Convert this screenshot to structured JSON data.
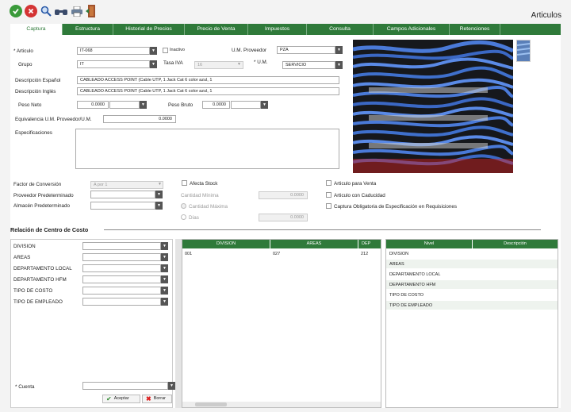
{
  "window_title": "Articulos",
  "tabs": [
    "Captura",
    "Estructura",
    "Historial de Precios",
    "Precio de Venta",
    "Impuestos",
    "Consulta",
    "Campos Adicionales",
    "Retenciones"
  ],
  "form": {
    "articulo_label": "* Articulo",
    "articulo_value": "IT-068",
    "inactivo_label": "Inactivo",
    "um_proveedor_label": "U.M. Proveedor",
    "um_proveedor_value": "PZA",
    "grupo_label": "Grupo",
    "grupo_value": "IT",
    "tasa_iva_label": "Tasa IVA",
    "tasa_iva_value": "16",
    "um_label": "* U.M.",
    "um_value": "SERVICIO",
    "desc_es_label": "Descripción Español",
    "desc_es_value": "CABLEADO ACCESS POINT (Cable UTP, 1 Jack Cat 6 color azul, 1",
    "desc_en_label": "Descripción Inglés",
    "desc_en_value": "CABLEADO ACCESS POINT (Cable UTP, 1 Jack Cat 6 color azul, 1",
    "peso_neto_label": "Peso Neto",
    "peso_neto_value": "0.0000",
    "peso_bruto_label": "Peso Bruto",
    "peso_bruto_value": "0.0000",
    "equivalencia_label": "Equivalencia U.M. Proveedor/U.M.",
    "equivalencia_value": "0.0000",
    "especificaciones_label": "Especificaciones"
  },
  "options": {
    "factor_label": "Factor de Conversión",
    "factor_value": "A por 1",
    "proveedor_label": "Proveedor Predeterminado",
    "almacen_label": "Almacén Predeterminado",
    "afecta_stock": "Afecta Stock",
    "cantidad_minima": "Cantidad Mínima",
    "cantidad_minima_value": "0.0000",
    "cantidad_maxima": "Cantidad Máxima",
    "dias": "Días",
    "dias_value": "0.0000",
    "articulo_venta": "Articulo para Venta",
    "articulo_caducidad": "Articulo con Caducidad",
    "captura_obligatoria": "Captura Obligatoria de Especificación en Requisiciones"
  },
  "cost_center": {
    "title": "Relación de Centro de Costo",
    "fields": [
      "DIVISION",
      "AREAS",
      "DEPARTAMENTO LOCAL",
      "DEPARTAMENTO HFM",
      "TIPO DE COSTO",
      "TIPO DE EMPLEADO"
    ],
    "grid_headers": [
      "DIVISION",
      "AREAS",
      "DEP"
    ],
    "grid_row": [
      "001",
      "027",
      "212"
    ],
    "nivel_headers": [
      "Nivel",
      "Descripción"
    ],
    "nivel_rows": [
      "DIVISION",
      "AREAS",
      "DEPARTAMENTO LOCAL",
      "DEPARTAMENTO HFM",
      "TIPO DE COSTO",
      "TIPO DE EMPLEADO"
    ],
    "cuenta_label": "* Cuenta",
    "aceptar_label": "Aceptar",
    "borrar_label": "Borrar"
  },
  "colors": {
    "accent": "#2f7a3a",
    "tab_border": "#7cae84"
  }
}
